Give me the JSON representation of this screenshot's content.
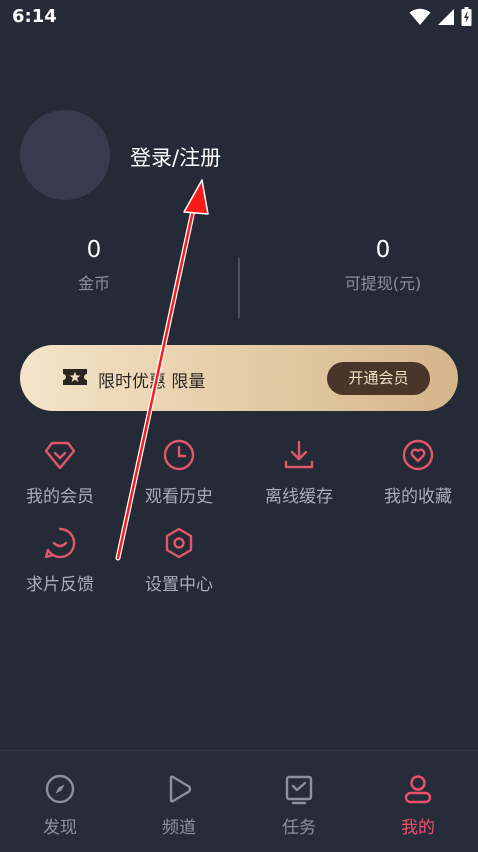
{
  "status_bar": {
    "time": "6:14",
    "icons": [
      "wifi-icon",
      "signal-icon",
      "battery-icon"
    ]
  },
  "profile": {
    "login_label": "登录/注册"
  },
  "stats": [
    {
      "value": "0",
      "label": "金币"
    },
    {
      "value": "0",
      "label": "可提现(元)"
    }
  ],
  "promo": {
    "text": "限时优惠 限量",
    "button_label": "开通会员",
    "icon": "ticket-star-icon"
  },
  "menu": [
    {
      "label": "我的会员",
      "icon": "diamond-icon"
    },
    {
      "label": "观看历史",
      "icon": "clock-icon"
    },
    {
      "label": "离线缓存",
      "icon": "download-icon"
    },
    {
      "label": "我的收藏",
      "icon": "heart-icon"
    },
    {
      "label": "求片反馈",
      "icon": "feedback-icon"
    },
    {
      "label": "设置中心",
      "icon": "settings-icon"
    }
  ],
  "bottom_nav": [
    {
      "label": "发现",
      "icon": "compass-icon",
      "active": false
    },
    {
      "label": "频道",
      "icon": "play-icon",
      "active": false
    },
    {
      "label": "任务",
      "icon": "task-icon",
      "active": false
    },
    {
      "label": "我的",
      "icon": "user-icon",
      "active": true
    }
  ],
  "colors": {
    "background": "#252a37",
    "accent": "#f0506a",
    "menu_icon": "#e0566a",
    "promo_gradient_start": "#f4e4c9",
    "promo_gradient_end": "#d5b58a",
    "promo_button": "#4b352b",
    "annotation_arrow": "#ff1a1a"
  }
}
